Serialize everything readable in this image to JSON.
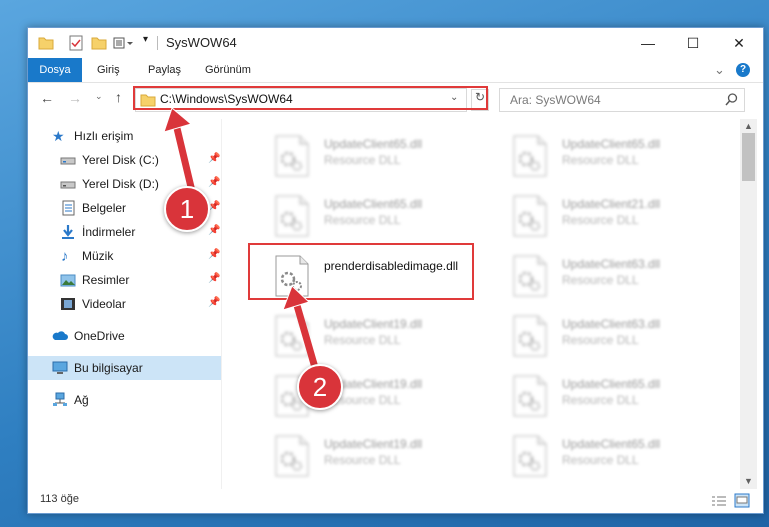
{
  "window": {
    "title": "SysWOW64",
    "controls": {
      "minimize": "—",
      "maximize": "☐",
      "close": "✕"
    }
  },
  "ribbon": {
    "tabs": [
      {
        "label": "Dosya",
        "active": true
      },
      {
        "label": "Giriş"
      },
      {
        "label": "Paylaş"
      },
      {
        "label": "Görünüm"
      }
    ],
    "expand_glyph": "⌄",
    "help_glyph": "?"
  },
  "navigation": {
    "address": "C:\\Windows\\SysWOW64",
    "search_placeholder": "Ara: SysWOW64"
  },
  "sidebar": {
    "items": [
      {
        "label": "Hızlı erişim",
        "icon": "star-icon",
        "pinned": false
      },
      {
        "label": "Yerel Disk (C:)",
        "icon": "drive-icon",
        "pinned": true
      },
      {
        "label": "Yerel Disk (D:)",
        "icon": "drive-icon",
        "pinned": true
      },
      {
        "label": "Belgeler",
        "icon": "documents-icon",
        "pinned": true
      },
      {
        "label": "İndirmeler",
        "icon": "download-icon",
        "pinned": true
      },
      {
        "label": "Müzik",
        "icon": "music-icon",
        "pinned": true
      },
      {
        "label": "Resimler",
        "icon": "pictures-icon",
        "pinned": true
      },
      {
        "label": "Videolar",
        "icon": "videos-icon",
        "pinned": true
      },
      {
        "label": "OneDrive",
        "icon": "cloud-icon"
      },
      {
        "label": "Bu bilgisayar",
        "icon": "computer-icon",
        "selected": true
      },
      {
        "label": "Ağ",
        "icon": "network-icon"
      }
    ]
  },
  "files": {
    "column_left": [
      {
        "name": "UpdateClient65.dll",
        "desc": "Resource DLL"
      },
      {
        "name": "UpdateClient65.dll",
        "desc": "Resource DLL"
      },
      {
        "name": "prenderdisabledimage.dll",
        "desc": "",
        "selected": true
      },
      {
        "name": "UpdateClient19.dll",
        "desc": "Resource DLL"
      },
      {
        "name": "UpdateClient19.dll",
        "desc": "Resource DLL"
      },
      {
        "name": "UpdateClient19.dll",
        "desc": "Resource DLL"
      }
    ],
    "column_right": [
      {
        "name": "UpdateClient65.dll",
        "desc": "Resource DLL"
      },
      {
        "name": "UpdateClient21.dll",
        "desc": "Resource DLL"
      },
      {
        "name": "UpdateClient63.dll",
        "desc": "Resource DLL"
      },
      {
        "name": "UpdateClient63.dll",
        "desc": "Resource DLL"
      },
      {
        "name": "UpdateClient65.dll",
        "desc": "Resource DLL"
      },
      {
        "name": "UpdateClient65.dll",
        "desc": "Resource DLL"
      }
    ]
  },
  "status": {
    "count": "113 öğe"
  },
  "callouts": {
    "one": "1",
    "two": "2"
  },
  "colors": {
    "accent": "#1979ca",
    "highlight": "#e03a3a",
    "callout": "#d9343a",
    "selection": "#cce4f7"
  }
}
